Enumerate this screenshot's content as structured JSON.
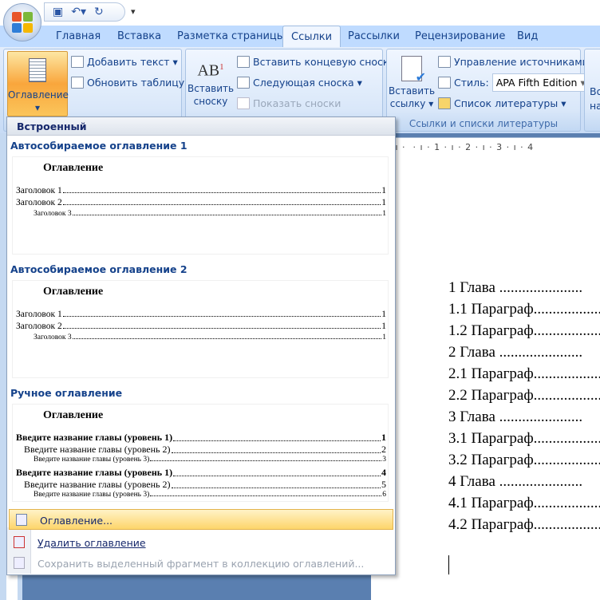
{
  "qat": {
    "icons": [
      "save-icon",
      "undo-icon",
      "redo-icon",
      "customize-icon"
    ]
  },
  "tabs": [
    "Главная",
    "Вставка",
    "Разметка страницы",
    "Ссылки",
    "Рассылки",
    "Рецензирование",
    "Вид"
  ],
  "active_tab": "Ссылки",
  "ribbon": {
    "toc_button": "Оглавление",
    "add_text": "Добавить текст",
    "update_table": "Обновить таблицу",
    "insert_footnote_1": "Вставить",
    "insert_footnote_2": "сноску",
    "insert_endnote": "Вставить концевую сноску",
    "next_footnote": "Следующая сноска",
    "show_notes": "Показать сноски",
    "insert_citation_1": "Вставить",
    "insert_citation_2": "ссылку",
    "manage_sources": "Управление источниками",
    "style_label": "Стиль:",
    "style_value": "APA Fifth Edition",
    "bibliography": "Список литературы",
    "group_citations": "Ссылки и списки литературы",
    "cut_1": "Во",
    "cut_2": "на"
  },
  "ruler": "· 1 · ı ·  · ı · 1 · ı · 2 · ı · 3 · ı · 4",
  "dropdown": {
    "header": "Встроенный",
    "sections": [
      {
        "title": "Автособираемое оглавление 1",
        "preview_title": "Оглавление",
        "rows": [
          [
            "Заголовок 1",
            "1"
          ],
          [
            "Заголовок 2",
            "1"
          ],
          [
            "Заголовок 3",
            "1"
          ]
        ]
      },
      {
        "title": "Автособираемое оглавление 2",
        "preview_title": "Оглавление",
        "rows": [
          [
            "Заголовок 1",
            "1"
          ],
          [
            "Заголовок 2",
            "1"
          ],
          [
            "Заголовок 3",
            "1"
          ]
        ]
      },
      {
        "title": "Ручное оглавление",
        "preview_title": "Оглавление",
        "rows": [
          [
            "Введите название главы (уровень 1)",
            "1"
          ],
          [
            "Введите название главы (уровень 2)",
            "2"
          ],
          [
            "Введите название главы (уровень 3)",
            "3"
          ],
          [
            "Введите название главы (уровень 1)",
            "4"
          ],
          [
            "Введите название главы (уровень 2)",
            "5"
          ],
          [
            "Введите название главы (уровень 3)",
            "6"
          ]
        ]
      }
    ],
    "menu": [
      "Оглавление...",
      "Удалить оглавление",
      "Сохранить выделенный фрагмент в коллекцию оглавлений..."
    ]
  },
  "document": {
    "lines": [
      "1 Глава ......................",
      "1.1 Параграф..................",
      "1.2 Параграф..................",
      "2 Глава ......................",
      "2.1 Параграф..................",
      "2.2 Параграф..................",
      "3 Глава ......................",
      "3.1 Параграф..................",
      "3.2 Параграф..................",
      "4 Глава ......................",
      "4.1 Параграф..................",
      "4.2 Параграф.................."
    ]
  },
  "colors": {
    "tab_bar": "#bfdbff",
    "highlight": "#fbc55b",
    "text": "#15428b"
  }
}
